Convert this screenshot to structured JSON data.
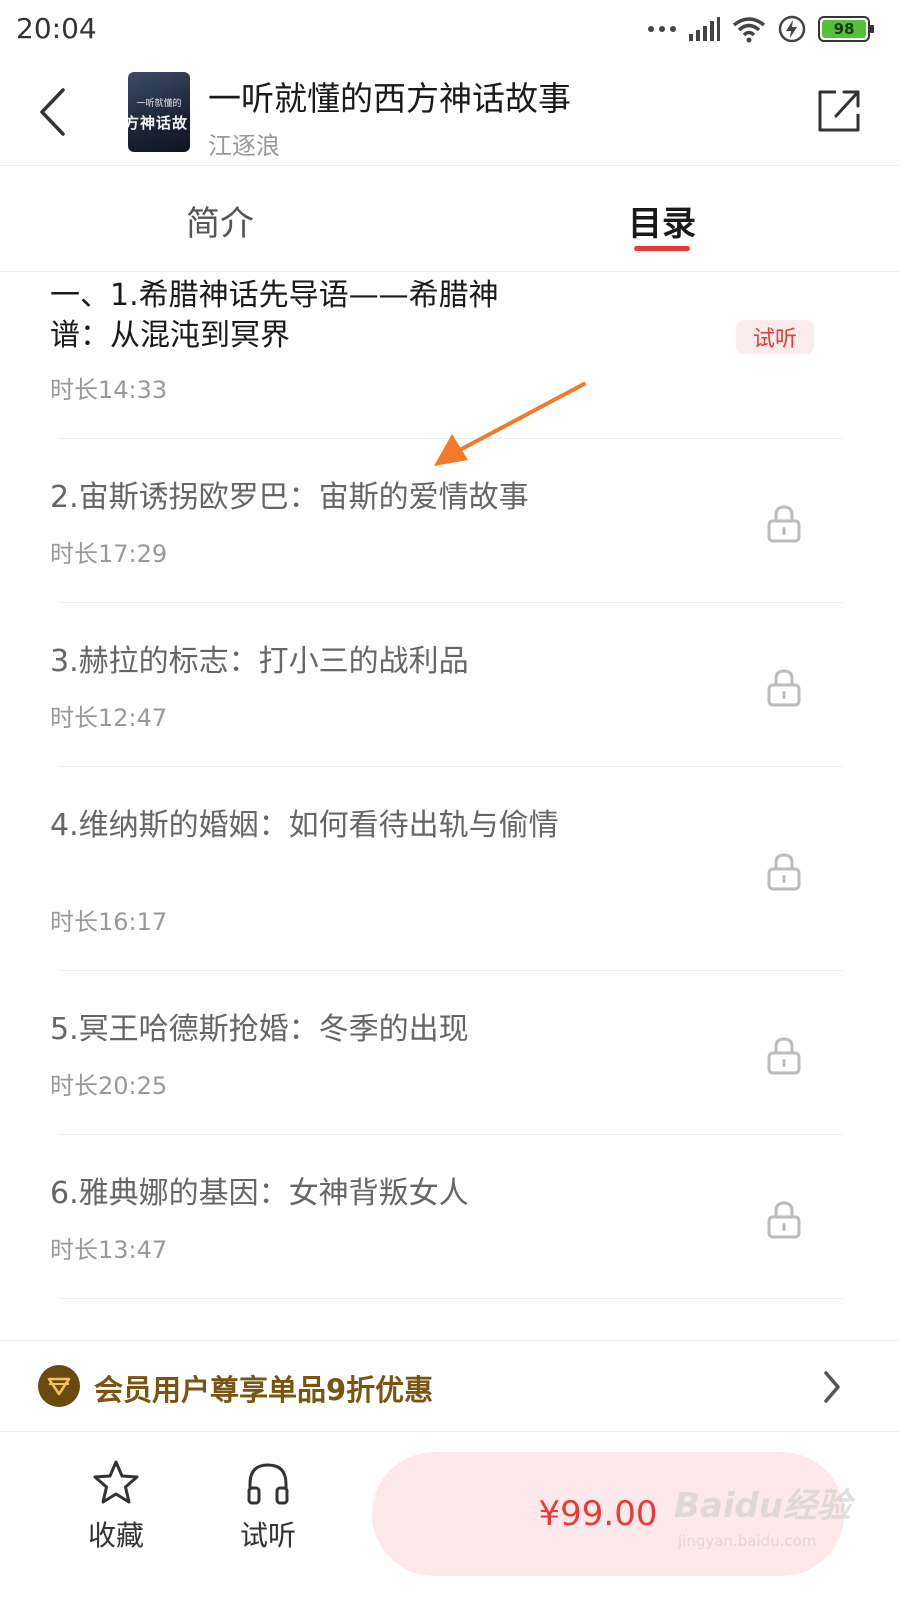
{
  "status_bar": {
    "time": "20:04",
    "battery_level": "98"
  },
  "header": {
    "cover_top_text": "一听就懂的",
    "cover_main_text": "方神话故",
    "title": "一听就懂的西方神话故事",
    "author": "江逐浪"
  },
  "tabs": {
    "intro_label": "简介",
    "catalog_label": "目录",
    "active": "目录"
  },
  "chapters": [
    {
      "title": "一、1.希腊神话先导语——希腊神谱：从混沌到冥界",
      "duration": "时长14:33",
      "badge": "试听",
      "locked": false
    },
    {
      "title": "2.宙斯诱拐欧罗巴：宙斯的爱情故事",
      "duration": "时长17:29",
      "locked": true
    },
    {
      "title": "3.赫拉的标志：打小三的战利品",
      "duration": "时长12:47",
      "locked": true
    },
    {
      "title": "4.维纳斯的婚姻：如何看待出轨与偷情",
      "duration": "时长16:17",
      "locked": true
    },
    {
      "title": "5.冥王哈德斯抢婚：冬季的出现",
      "duration": "时长20:25",
      "locked": true
    },
    {
      "title": "6.雅典娜的基因：女神背叛女人",
      "duration": "时长13:47",
      "locked": true
    }
  ],
  "member_banner": {
    "text": "会员用户尊享单品9折优惠"
  },
  "bottom_bar": {
    "favorite_label": "收藏",
    "trial_label": "试听",
    "price": "¥99.00"
  },
  "watermark": {
    "brand": "Baidu经验",
    "url": "jingyan.baidu.com"
  },
  "colors": {
    "accent": "#e83a3a",
    "badge_bg": "#fdecec",
    "member_gold": "#7a5510",
    "battery_green": "#57c03a",
    "annotation_arrow": "#f27a2a"
  },
  "icons": [
    "back-arrow-icon",
    "share-icon",
    "lock-icon",
    "star-icon",
    "headphones-icon",
    "chevron-right-icon",
    "member-diamond-icon",
    "signal-icon",
    "wifi-icon",
    "charging-icon"
  ]
}
